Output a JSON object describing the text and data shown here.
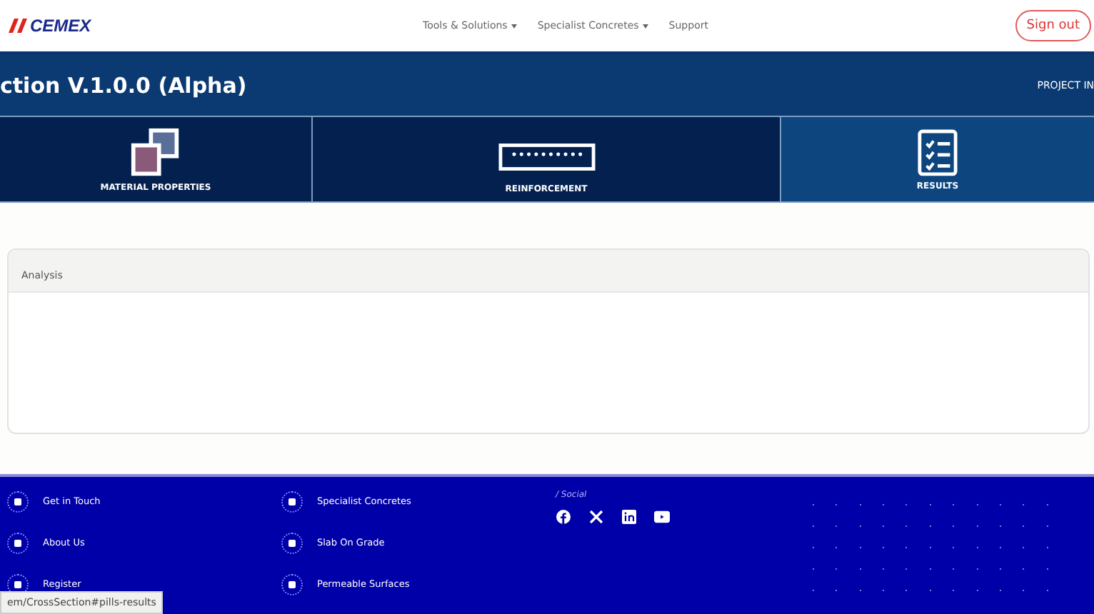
{
  "header": {
    "logo": "CEMEX",
    "nav": [
      {
        "label": "Tools & Solutions",
        "dropdown": true
      },
      {
        "label": "Specialist Concretes",
        "dropdown": true
      },
      {
        "label": "Support",
        "dropdown": false
      }
    ],
    "sign_out": "Sign out"
  },
  "title_bar": {
    "title": "ction V.1.0.0 (Alpha)",
    "right_text": "PROJECT IN"
  },
  "steps": [
    {
      "kind": "material",
      "label": "MATERIAL PROPERTIES",
      "selected": false
    },
    {
      "kind": "reinforcement",
      "label": "REINFORCEMENT",
      "selected": false
    },
    {
      "kind": "results",
      "label": "RESULTS",
      "selected": true
    }
  ],
  "analysis": {
    "title": "Analysis"
  },
  "footer": {
    "columns": [
      [
        {
          "label": "Get in Touch"
        },
        {
          "label": "About Us"
        },
        {
          "label": "Register"
        }
      ],
      [
        {
          "label": "Specialist Concretes"
        },
        {
          "label": "Slab On Grade"
        },
        {
          "label": "Permeable Surfaces"
        }
      ]
    ],
    "social_title": "/ Social",
    "social": [
      {
        "kind": "facebook"
      },
      {
        "kind": "x"
      },
      {
        "kind": "linkedin"
      },
      {
        "kind": "youtube"
      }
    ]
  },
  "status_url": "em/CrossSection#pills-results"
}
